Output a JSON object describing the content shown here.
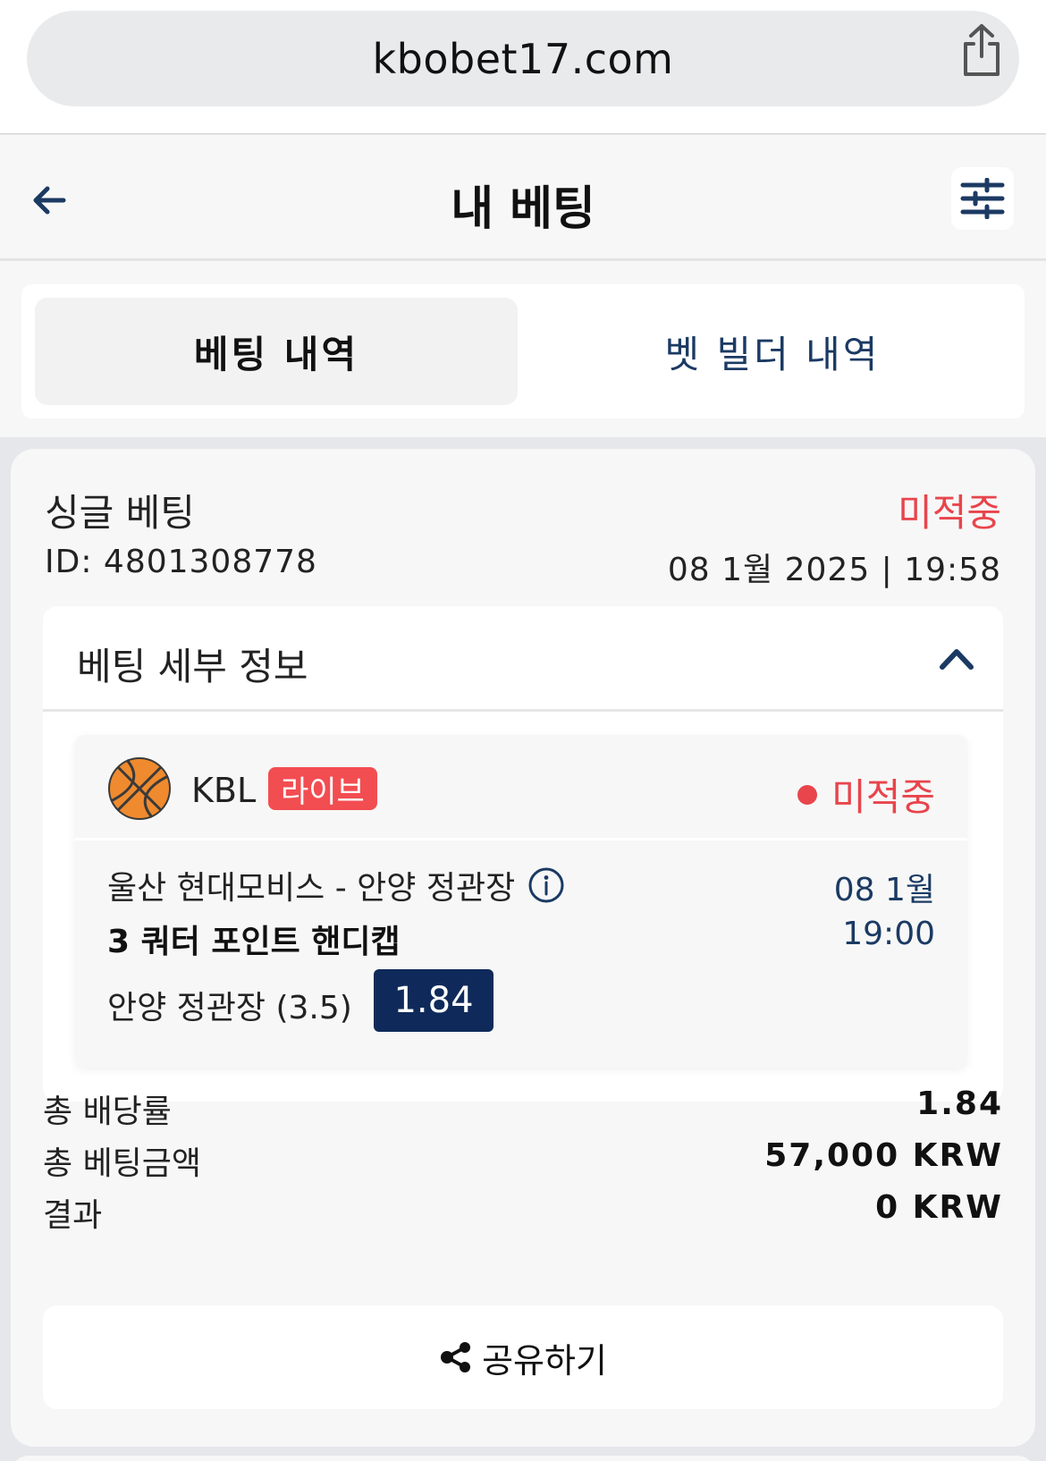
{
  "browser": {
    "url": "kbobet17.com"
  },
  "header": {
    "title": "내 베팅"
  },
  "tabs": [
    {
      "label": "베팅 내역",
      "active": true
    },
    {
      "label": "벳 빌더 내역",
      "active": false
    }
  ],
  "bet": {
    "type": "싱글 베팅",
    "status": "미적중",
    "id": "ID: 4801308778",
    "datetime": "08 1월 2025 | 19:58",
    "details_title": "베팅 세부 정보",
    "event": {
      "league": "KBL",
      "live_badge": "라이브",
      "status": "미적중",
      "match": "울산 현대모비스 - 안양 정관장",
      "date": "08 1월",
      "market": "3 쿼터 포인트 핸디캡",
      "time": "19:00",
      "selection": "안양 정관장 (3.5)",
      "odds": "1.84"
    },
    "summary": [
      {
        "label": "총 배당률",
        "value": "1.84"
      },
      {
        "label": "총 베팅금액",
        "value": "57,000 KRW"
      },
      {
        "label": "결과",
        "value": "0 KRW"
      }
    ],
    "share_label": "공유하기"
  },
  "colors": {
    "accent_navy": "#0f2a5a",
    "lost_red": "#e8454c",
    "live_red": "#f24d51",
    "link_blue": "#1b3a63"
  },
  "icons": [
    "share-icon",
    "back-arrow-icon",
    "filter-sliders-icon",
    "chevron-up-icon",
    "basketball-icon",
    "info-icon",
    "share-nodes-icon"
  ]
}
